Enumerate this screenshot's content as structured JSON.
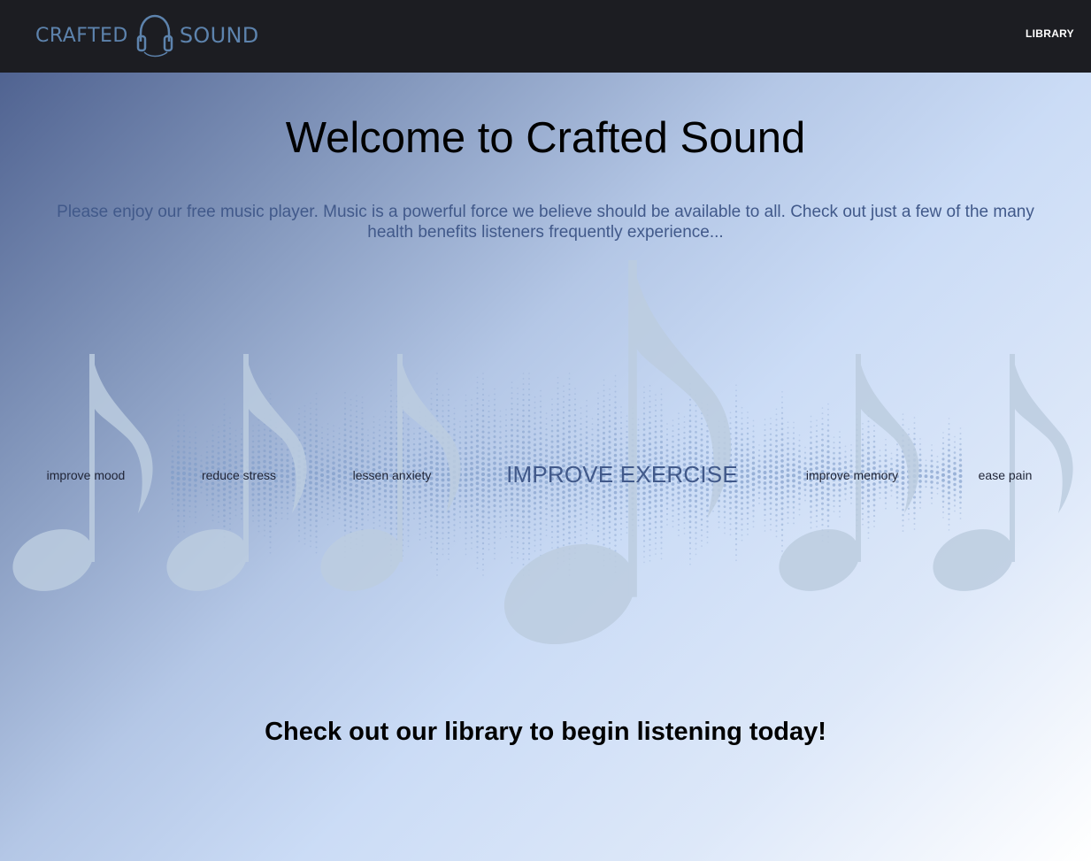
{
  "header": {
    "logo": {
      "word1": "CRAFTED",
      "word2": "SOUND",
      "icon": "headphones-icon"
    },
    "nav": {
      "library_label": "LIBRARY"
    }
  },
  "main": {
    "title": "Welcome to Crafted Sound",
    "intro": "Please enjoy our free music player. Music is a powerful force we believe should be available to all. Check out just a few of the many health benefits listeners frequently experience...",
    "benefits": [
      "improve mood",
      "reduce stress",
      "lessen anxiety",
      "IMPROVE EXERCISE",
      "improve memory",
      "ease pain"
    ],
    "cta": "Check out our library to begin listening today!"
  },
  "colors": {
    "header_bg": "#1c1d22",
    "logo": "#5d83ad",
    "intro_text": "#41598a",
    "note_fill": "#bccde0"
  }
}
